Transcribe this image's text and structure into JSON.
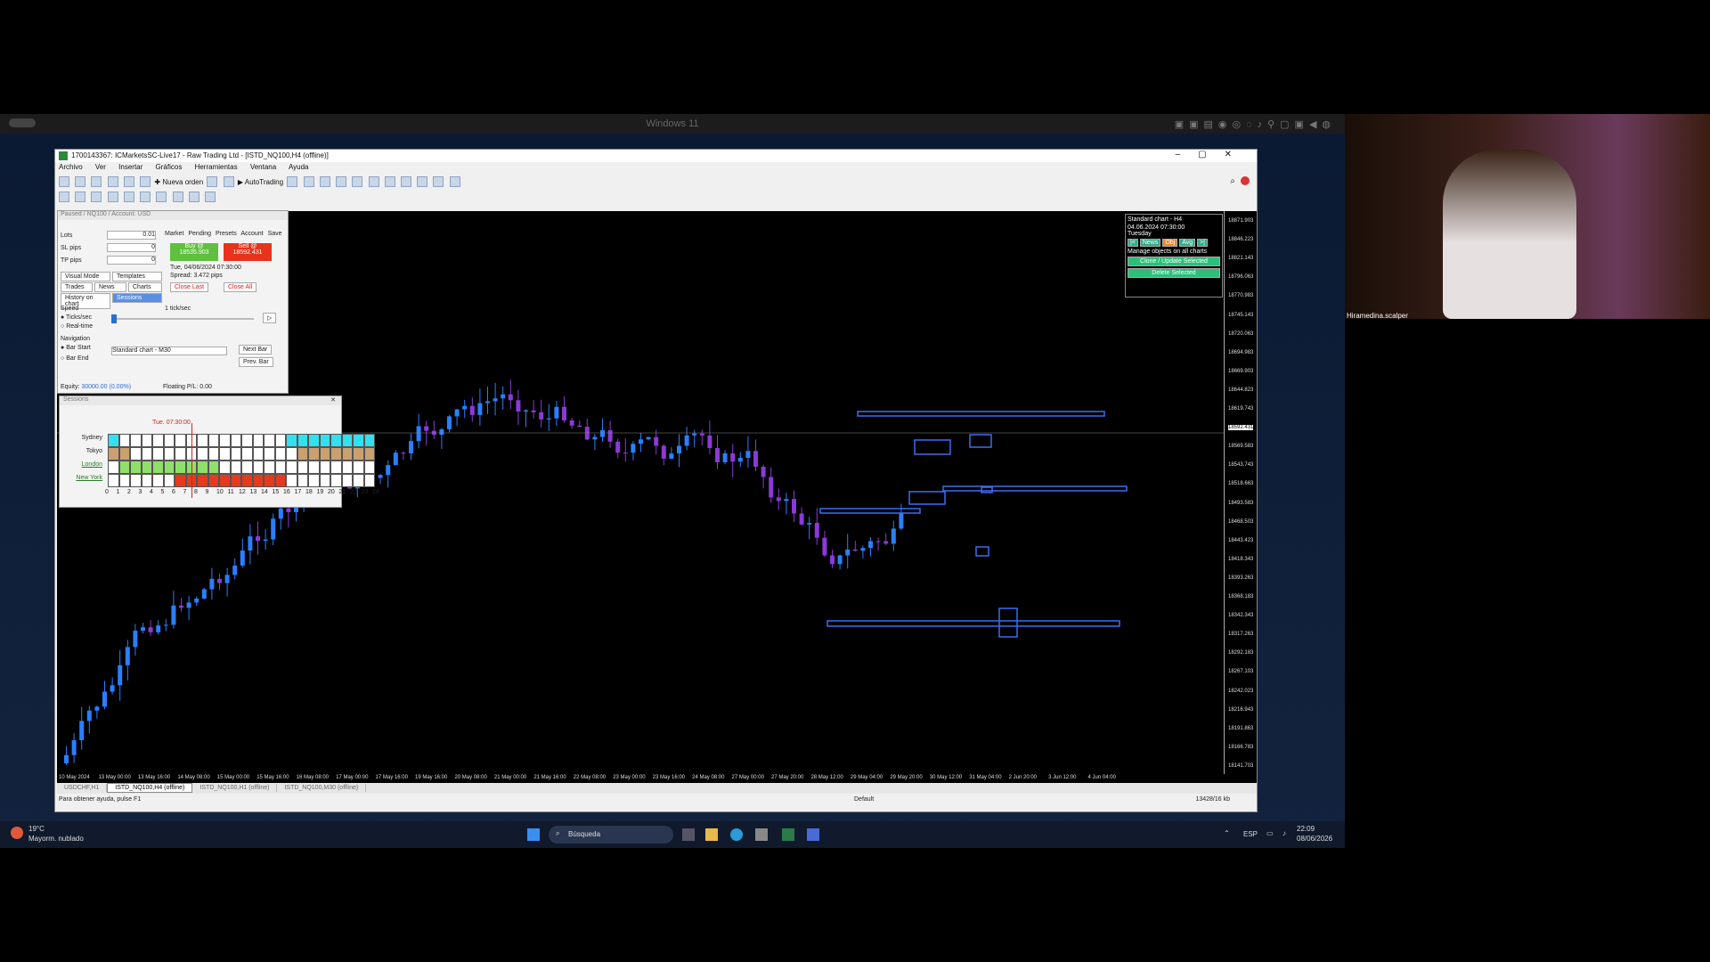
{
  "vm": {
    "title": "Windows 11"
  },
  "window": {
    "title": "1700143367: ICMarketsSC-Live17 - Raw Trading Ltd - [ISTD_NQ100,H4 (offline)]",
    "menu": [
      "Archivo",
      "Ver",
      "Insertar",
      "Gráficos",
      "Herramientas",
      "Ventana",
      "Ayuda"
    ],
    "toolbar": {
      "new_order": "Nueva orden",
      "autotrading": "AutoTrading"
    }
  },
  "trade_panel": {
    "title": "Paused / NQ100 / Account: USD",
    "lots_label": "Lots",
    "lots_value": "0.01",
    "sl_label": "SL pips",
    "sl_value": "0",
    "tp_label": "TP pips",
    "tp_value": "0",
    "tabs": [
      "Market",
      "Pending",
      "Presets",
      "Account",
      "Save"
    ],
    "buy_label": "Buy @",
    "buy_price": "18535.903",
    "sell_label": "Sell @",
    "sell_price": "18592.431",
    "datetime": "Tue, 04/06/2024  07:30:00",
    "spread": "Spread: 3.472 pips",
    "close_last": "Close Last",
    "close_all": "Close All",
    "visual_mode": "Visual Mode",
    "templates": "Templates",
    "trades": "Trades",
    "news": "News",
    "charts": "Charts",
    "history_on_chart": "History on chart",
    "sessions": "Sessions",
    "speed_label": "Speed",
    "speed_value": "1 tick/sec",
    "ticks_sec": "Ticks/sec",
    "real_time": "Real-time",
    "navigation_label": "Navigation",
    "bar_start": "Bar Start",
    "bar_end": "Bar End",
    "chart_select": "Standard chart - M30",
    "next_bar": "Next Bar",
    "prev_bar": "Prev. Bar",
    "equity_label": "Equity:",
    "equity_value": "30000.00",
    "equity_pct": "(0.00%)",
    "floating_label": "Floating P/L:",
    "floating_value": "0.00"
  },
  "sessions_panel": {
    "title": "Sessions",
    "time_marker": "Tue. 07:30:00",
    "rows": [
      "Sydney",
      "Tokyo",
      "London",
      "New York"
    ],
    "hours": [
      "0",
      "1",
      "2",
      "3",
      "4",
      "5",
      "6",
      "7",
      "8",
      "9",
      "10",
      "11",
      "12",
      "13",
      "14",
      "15",
      "16",
      "17",
      "18",
      "19",
      "20",
      "21",
      "22",
      "23",
      "24"
    ],
    "colors": {
      "sydney": "#33e0f0",
      "tokyo": "#caa071",
      "london": "#8fe06a",
      "newyork": "#e63a1c"
    }
  },
  "chart_info": {
    "line1": "Standard chart - H4",
    "line2": "04.06.2024  07:30:00",
    "line3": "Tuesday",
    "news": "News",
    "obj": "Obj",
    "avg": "Avg",
    "manage": "Manage objects on all charts",
    "clone": "Clone / Update Selected",
    "delete": "Delete Selected"
  },
  "price_axis": [
    "18871.903",
    "18846.223",
    "18821.143",
    "18796.063",
    "18770.983",
    "18745.143",
    "18720.063",
    "18694.983",
    "18669.903",
    "18644.823",
    "18619.743",
    "18592.431",
    "18569.583",
    "18543.743",
    "18518.663",
    "18493.583",
    "18468.503",
    "18443.423",
    "18418.343",
    "18393.263",
    "18368.183",
    "18342.343",
    "18317.263",
    "18292.183",
    "18267.103",
    "18242.023",
    "18216.943",
    "18191.863",
    "18166.783",
    "18141.703"
  ],
  "time_axis": [
    "10 May 2024",
    "13 May 00:00",
    "13 May 16:00",
    "14 May 08:00",
    "15 May 00:00",
    "15 May 16:00",
    "16 May 08:00",
    "17 May 00:00",
    "17 May 16:00",
    "19 May 16:00",
    "20 May 08:00",
    "21 May 00:00",
    "21 May 16:00",
    "22 May 08:00",
    "23 May 00:00",
    "23 May 16:00",
    "24 May 08:00",
    "27 May 00:00",
    "27 May 20:00",
    "28 May 12:00",
    "29 May 04:00",
    "29 May 20:00",
    "30 May 12:00",
    "31 May 04:00",
    "2 Jun 20:00",
    "3 Jun 12:00",
    "4 Jun 04:00"
  ],
  "tabs": [
    "USDCHF,H1",
    "ISTD_NQ100,H4 (offline)",
    "ISTD_NQ100,H1 (offline)",
    "ISTD_NQ100,M30 (offline)"
  ],
  "status": {
    "help": "Para obtener ayuda, pulse F1",
    "profile": "Default",
    "traffic": "13428/16 kb"
  },
  "taskbar": {
    "weather_temp": "19°C",
    "weather_desc": "Mayorm. nublado",
    "search": "Búsqueda",
    "lang": "ESP",
    "time": "22:09",
    "date": "08/06/2026"
  },
  "webcam": {
    "name": "Hiramedina.scalper"
  },
  "colors": {
    "bull": "#2a7fff",
    "bear": "#8a3ad6",
    "box": "#3a6ef0"
  }
}
